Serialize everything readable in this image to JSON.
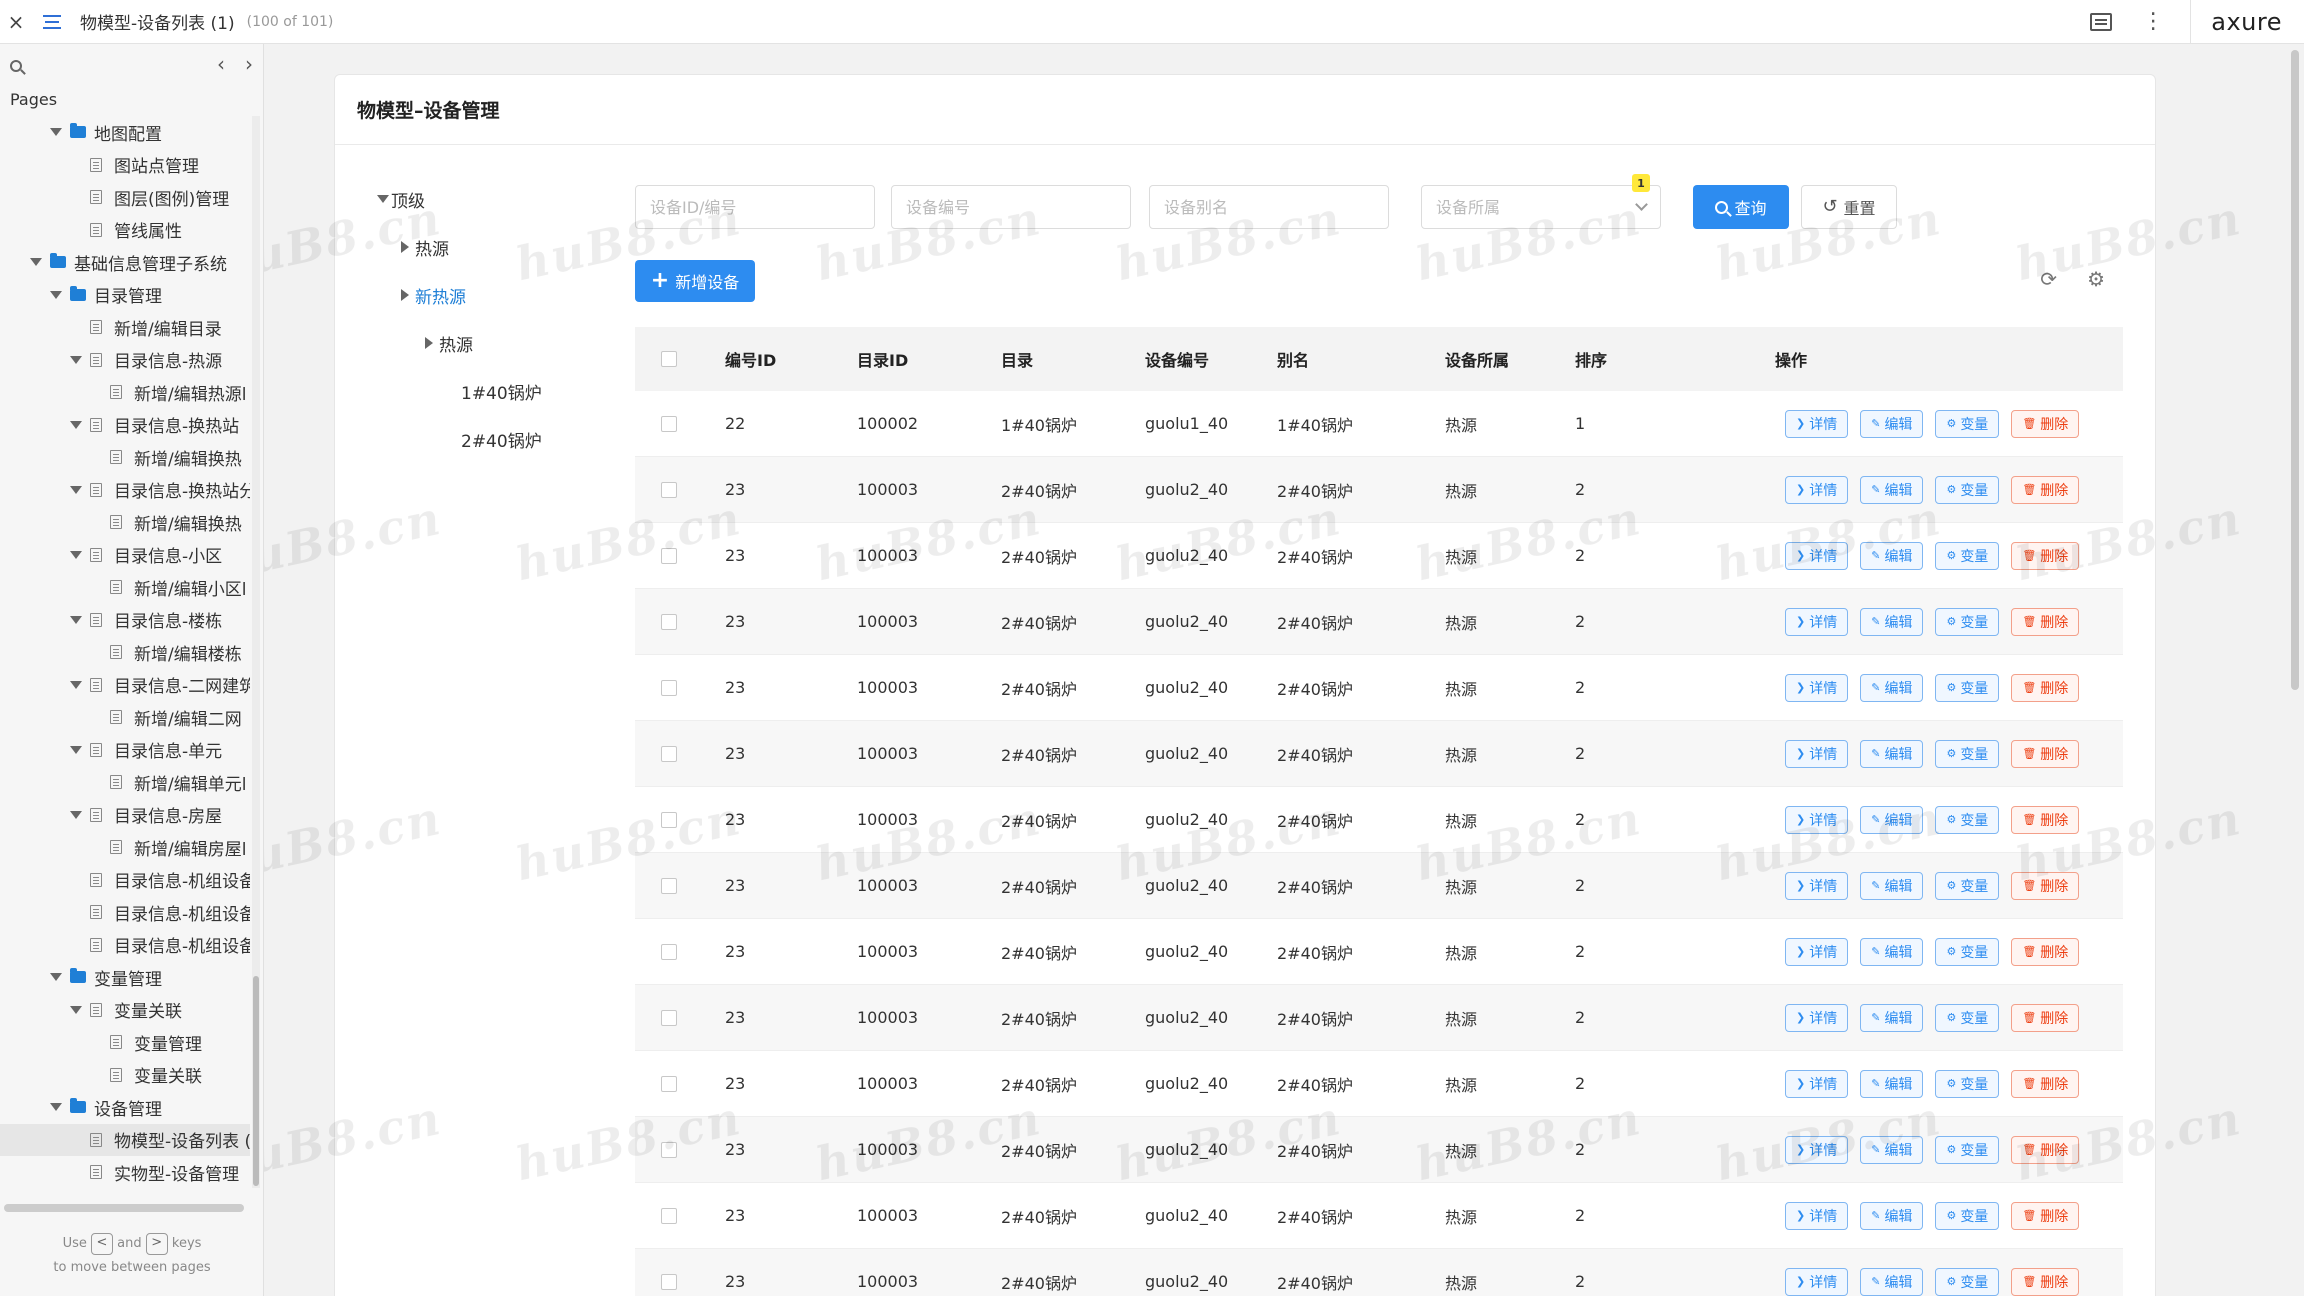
{
  "topbar": {
    "close_glyph": "×",
    "title": "物模型-设备列表 (1)",
    "count": "(100 of 101)",
    "more_glyph": "⋮",
    "logo": "axure"
  },
  "sidebar": {
    "pages_label": "Pages",
    "prev_glyph": "‹",
    "next_glyph": "›",
    "hint_use": "Use",
    "hint_and": "and",
    "hint_keys": "keys",
    "hint_line2": "to move between pages",
    "key_left": "<",
    "key_right": ">",
    "items": [
      {
        "label": "地图配置",
        "level": 2,
        "type": "folder",
        "open": true
      },
      {
        "label": "图站点管理",
        "level": 3,
        "type": "page"
      },
      {
        "label": "图层(图例)管理",
        "level": 3,
        "type": "page"
      },
      {
        "label": "管线属性",
        "level": 3,
        "type": "page"
      },
      {
        "label": "基础信息管理子系统",
        "level": 1,
        "type": "folder",
        "open": true
      },
      {
        "label": "目录管理",
        "level": 2,
        "type": "folder",
        "open": true
      },
      {
        "label": "新增/编辑目录",
        "level": 3,
        "type": "page"
      },
      {
        "label": "目录信息-热源",
        "level": 3,
        "type": "page",
        "open": true
      },
      {
        "label": "新增/编辑热源l",
        "level": 4,
        "type": "page"
      },
      {
        "label": "目录信息-换热站",
        "level": 3,
        "type": "page",
        "open": true
      },
      {
        "label": "新增/编辑换热",
        "level": 4,
        "type": "page"
      },
      {
        "label": "目录信息-换热站分",
        "level": 3,
        "type": "page",
        "open": true
      },
      {
        "label": "新增/编辑换热",
        "level": 4,
        "type": "page"
      },
      {
        "label": "目录信息-小区",
        "level": 3,
        "type": "page",
        "open": true
      },
      {
        "label": "新增/编辑小区l",
        "level": 4,
        "type": "page"
      },
      {
        "label": "目录信息-楼栋",
        "level": 3,
        "type": "page",
        "open": true
      },
      {
        "label": "新增/编辑楼栋",
        "level": 4,
        "type": "page"
      },
      {
        "label": "目录信息-二网建筑",
        "level": 3,
        "type": "page",
        "open": true
      },
      {
        "label": "新增/编辑二网",
        "level": 4,
        "type": "page"
      },
      {
        "label": "目录信息-单元",
        "level": 3,
        "type": "page",
        "open": true
      },
      {
        "label": "新增/编辑单元l",
        "level": 4,
        "type": "page"
      },
      {
        "label": "目录信息-房屋",
        "level": 3,
        "type": "page",
        "open": true
      },
      {
        "label": "新增/编辑房屋l",
        "level": 4,
        "type": "page"
      },
      {
        "label": "目录信息-机组设备",
        "level": 3,
        "type": "page"
      },
      {
        "label": "目录信息-机组设备",
        "level": 3,
        "type": "page"
      },
      {
        "label": "目录信息-机组设备",
        "level": 3,
        "type": "page"
      },
      {
        "label": "变量管理",
        "level": 2,
        "type": "folder",
        "open": true
      },
      {
        "label": "变量关联",
        "level": 3,
        "type": "page",
        "open": true
      },
      {
        "label": "变量管理",
        "level": 4,
        "type": "page"
      },
      {
        "label": "变量关联",
        "level": 4,
        "type": "page"
      },
      {
        "label": "设备管理",
        "level": 2,
        "type": "folder",
        "open": true
      },
      {
        "label": "物模型-设备列表 (",
        "level": 3,
        "type": "page",
        "selected": true
      },
      {
        "label": "实物型-设备管理",
        "level": 3,
        "type": "page"
      }
    ]
  },
  "main": {
    "card_title": "物模型–设备管理",
    "tree": [
      {
        "label": "顶级",
        "indent": 0,
        "arrow": "down"
      },
      {
        "label": "热源",
        "indent": 1,
        "arrow": "right"
      },
      {
        "label": "新热源",
        "indent": 1,
        "arrow": "right",
        "active": true
      },
      {
        "label": "热源",
        "indent": 2,
        "arrow": "right"
      },
      {
        "label": "1#40锅炉",
        "indent": 3,
        "arrow": "none"
      },
      {
        "label": "2#40锅炉",
        "indent": 3,
        "arrow": "none"
      }
    ],
    "filters": {
      "device_id_placeholder": "设备ID/编号",
      "device_code_placeholder": "设备编号",
      "device_alias_placeholder": "设备别名",
      "device_owner_placeholder": "设备所属",
      "badge": "1",
      "query_label": "查询",
      "reset_label": "重置",
      "reset_glyph": "↺"
    },
    "add_label": "新增设备",
    "add_glyph": "+",
    "refresh_glyph": "⟳",
    "settings_glyph": "⚙",
    "columns": [
      "编号ID",
      "目录ID",
      "目录",
      "设备编号",
      "别名",
      "设备所属",
      "排序",
      "操作"
    ],
    "actions": {
      "detail": "详情",
      "edit": "编辑",
      "var": "变量",
      "delete": "删除"
    },
    "action_glyphs": {
      "detail": "❯",
      "edit": "✎",
      "var": "⚙",
      "delete": "🗑"
    },
    "rows": [
      [
        "22",
        "100002",
        "1#40锅炉",
        "guolu1_40",
        "1#40锅炉",
        "热源",
        "1"
      ],
      [
        "23",
        "100003",
        "2#40锅炉",
        "guolu2_40",
        "2#40锅炉",
        "热源",
        "2"
      ],
      [
        "23",
        "100003",
        "2#40锅炉",
        "guolu2_40",
        "2#40锅炉",
        "热源",
        "2"
      ],
      [
        "23",
        "100003",
        "2#40锅炉",
        "guolu2_40",
        "2#40锅炉",
        "热源",
        "2"
      ],
      [
        "23",
        "100003",
        "2#40锅炉",
        "guolu2_40",
        "2#40锅炉",
        "热源",
        "2"
      ],
      [
        "23",
        "100003",
        "2#40锅炉",
        "guolu2_40",
        "2#40锅炉",
        "热源",
        "2"
      ],
      [
        "23",
        "100003",
        "2#40锅炉",
        "guolu2_40",
        "2#40锅炉",
        "热源",
        "2"
      ],
      [
        "23",
        "100003",
        "2#40锅炉",
        "guolu2_40",
        "2#40锅炉",
        "热源",
        "2"
      ],
      [
        "23",
        "100003",
        "2#40锅炉",
        "guolu2_40",
        "2#40锅炉",
        "热源",
        "2"
      ],
      [
        "23",
        "100003",
        "2#40锅炉",
        "guolu2_40",
        "2#40锅炉",
        "热源",
        "2"
      ],
      [
        "23",
        "100003",
        "2#40锅炉",
        "guolu2_40",
        "2#40锅炉",
        "热源",
        "2"
      ],
      [
        "23",
        "100003",
        "2#40锅炉",
        "guolu2_40",
        "2#40锅炉",
        "热源",
        "2"
      ],
      [
        "23",
        "100003",
        "2#40锅炉",
        "guolu2_40",
        "2#40锅炉",
        "热源",
        "2"
      ],
      [
        "23",
        "100003",
        "2#40锅炉",
        "guolu2_40",
        "2#40锅炉",
        "热源",
        "2"
      ]
    ]
  },
  "watermark": "huB8.cn"
}
